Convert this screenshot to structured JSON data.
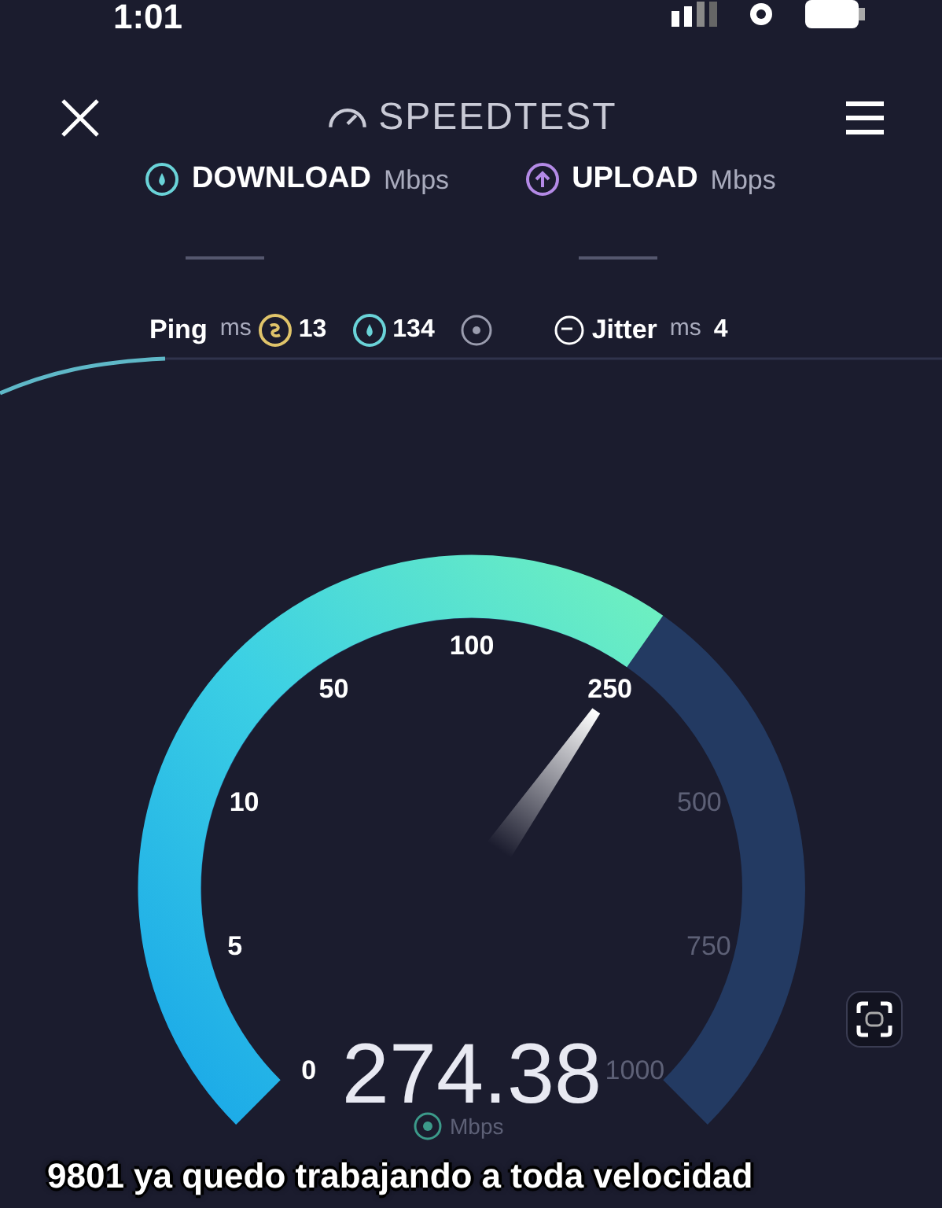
{
  "status_bar": {
    "time": "1:01"
  },
  "header": {
    "title": "SPEEDTEST"
  },
  "metrics": [
    {
      "kind": "download",
      "label": "DOWNLOAD",
      "unit": "Mbps"
    },
    {
      "kind": "upload",
      "label": "UPLOAD",
      "unit": "Mbps"
    }
  ],
  "ping": {
    "label": "Ping",
    "unit": "ms",
    "readings": [
      {
        "kind": "idle",
        "value": "13"
      },
      {
        "kind": "download",
        "value": "134"
      },
      {
        "kind": "upload"
      }
    ]
  },
  "jitter": {
    "label": "Jitter",
    "unit": "ms",
    "value": "4"
  },
  "gauge": {
    "ticks": [
      "0",
      "5",
      "10",
      "50",
      "100",
      "250",
      "500",
      "750",
      "1000"
    ],
    "reading": "274.38",
    "unit": "Mbps"
  },
  "caption": "9801 ya quedo trabajando a toda velocidad"
}
